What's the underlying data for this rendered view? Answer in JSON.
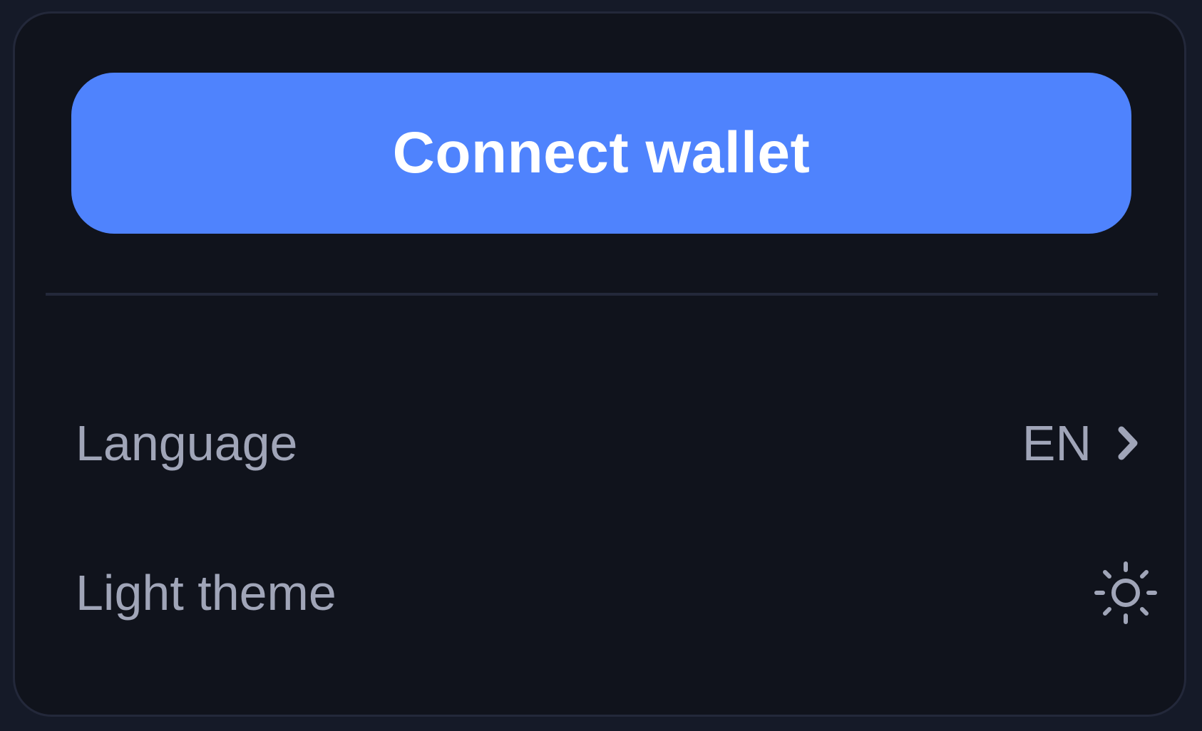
{
  "menu": {
    "connect_button_label": "Connect wallet",
    "items": [
      {
        "label": "Language",
        "value": "EN",
        "icon": "chevron-right-icon"
      },
      {
        "label": "Light theme",
        "icon": "sun-icon"
      }
    ]
  },
  "colors": {
    "accent": "#4f83fd",
    "panel_background": "#10131c",
    "text_muted": "#a0a5b8"
  }
}
